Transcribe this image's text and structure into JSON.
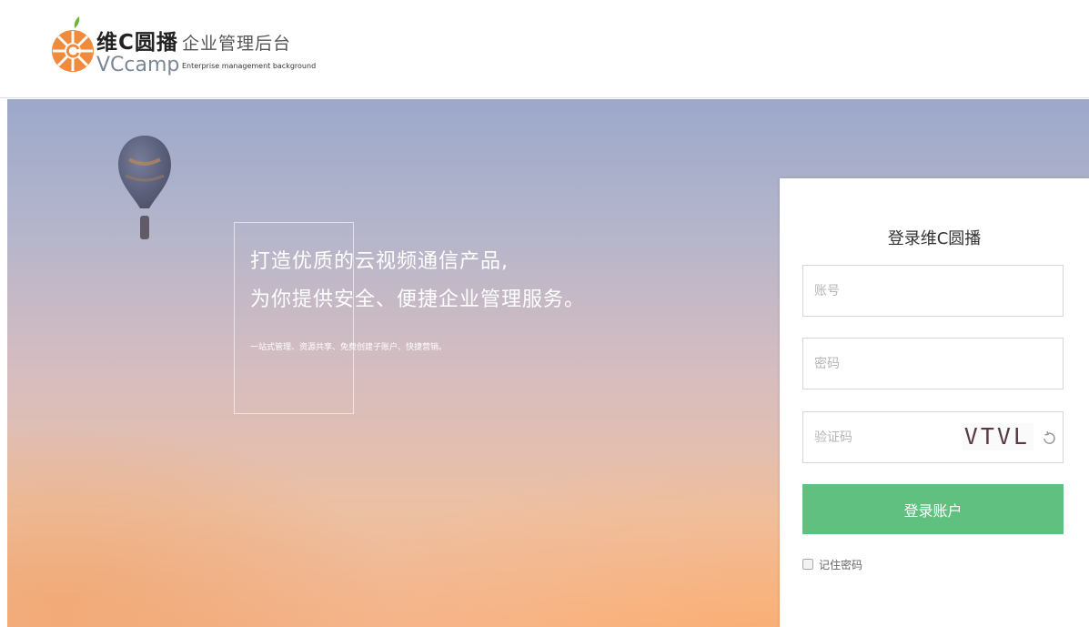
{
  "header": {
    "brand_cn": "维C圆播",
    "brand_en": "VCcamp",
    "system_cn": "企业管理后台",
    "system_en": "Enterprise management background",
    "logo_icon": "orange-slice-logo-icon",
    "logo_colors": [
      "#f08a3c",
      "#6bb53a"
    ]
  },
  "hero": {
    "slogan_line1": "打造优质的云视频通信产品,",
    "slogan_line2": "为你提供安全、便捷企业管理服务。",
    "slogan_sub": "一站式管理、资源共享、免费创建子账户、快捷营销。",
    "balloon_icon": "hot-air-balloon-icon"
  },
  "login": {
    "title": "登录维C圆播",
    "account_placeholder": "账号",
    "account_value": "",
    "password_placeholder": "密码",
    "password_value": "",
    "captcha_placeholder": "验证码",
    "captcha_value": "",
    "captcha_code": "VTVL",
    "refresh_icon": "refresh-icon",
    "submit_label": "登录账户",
    "remember_label": "记住密码",
    "remember_checked": false
  },
  "colors": {
    "accent_green": "#5fc07f",
    "brand_orange": "#f08a3c"
  }
}
